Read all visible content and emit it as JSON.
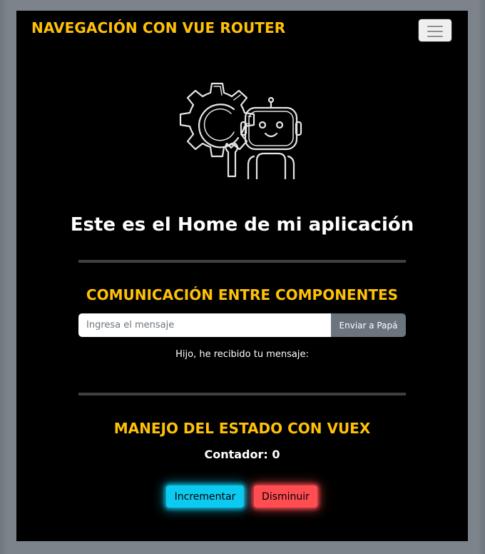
{
  "navbar": {
    "brand": "NAVEGACIÓN CON VUE ROUTER",
    "toggler_icon": "hamburger-menu-icon"
  },
  "home": {
    "illustration": "robot-gear-wrench-illustration",
    "title": "Este es el Home de mi aplicación"
  },
  "communication": {
    "title": "COMUNICACIÓN ENTRE COMPONENTES",
    "input": {
      "value": "",
      "placeholder": "Ingresa el mensaje"
    },
    "send_label": "Enviar a Papá",
    "received_text": "Hijo, he recibido tu mensaje:"
  },
  "vuex": {
    "title": "MANEJO DEL ESTADO CON VUEX",
    "counter_text": "Contador: 0",
    "increment_label": "Incrementar",
    "decrement_label": "Disminuir"
  },
  "colors": {
    "background": "#000000",
    "accent": "#ffc107",
    "info": "#0dcaf0",
    "danger": "#ff4d52",
    "secondary": "#6c757d"
  }
}
